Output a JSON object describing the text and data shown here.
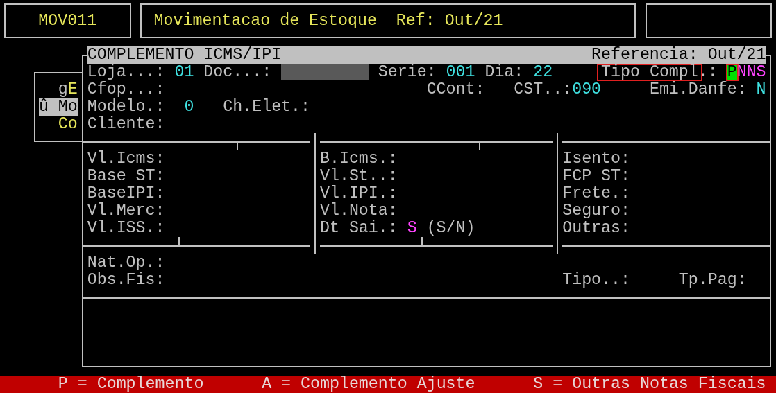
{
  "header": {
    "program_code": "MOV011",
    "title": "Movimentacao de Estoque",
    "reference": "Ref: Out/21"
  },
  "background_menu": {
    "items": [
      {
        "parts": [
          {
            "text": "g",
            "hotkey": false
          },
          {
            "text": "E",
            "hotkey": true
          }
        ],
        "selected": false
      },
      {
        "parts": [
          {
            "text": "û Mo"
          }
        ],
        "selected": true
      },
      {
        "parts": [
          {
            "text": "Co",
            "hotkey": true
          }
        ],
        "selected": false
      }
    ]
  },
  "dialog": {
    "title": "COMPLEMENTO ICMS/IPI",
    "reference": "Referencia: Out/21",
    "loja": {
      "label": "Loja...:",
      "value": "01"
    },
    "doc": {
      "label": "Doc...:",
      "redacted": true
    },
    "serie": {
      "label": "Serie:",
      "value": "001"
    },
    "dia": {
      "label": "Dia:",
      "value": "22"
    },
    "tipo_compl": {
      "label": "Tipo Compl",
      "highlighted": true,
      "suffix": ".:",
      "options": [
        {
          "char": "P",
          "cursor": true
        },
        {
          "char": "N",
          "cursor": false
        },
        {
          "char": "N",
          "cursor": false
        },
        {
          "char": "S",
          "cursor": false
        }
      ]
    },
    "cfop": {
      "label": "Cfop...:"
    },
    "ccont": {
      "label": "CCont:"
    },
    "cst": {
      "label": "CST..:",
      "value": "090"
    },
    "emi_danfe": {
      "label": "Emi.Danfe:",
      "value": "N"
    },
    "modelo": {
      "label": "Modelo.:",
      "value": "0"
    },
    "ch_elet": {
      "label": "Ch.Elet.:"
    },
    "cliente": {
      "label": "Cliente:"
    },
    "value_columns": [
      [
        {
          "label": "Vl.Icms:"
        },
        {
          "label": "Base ST:"
        },
        {
          "label": "BaseIPI:"
        },
        {
          "label": "Vl.Merc:"
        },
        {
          "label": "Vl.ISS.:"
        }
      ],
      [
        {
          "label": "B.Icms.:"
        },
        {
          "label": "Vl.St..:"
        },
        {
          "label": "Vl.IPI.:"
        },
        {
          "label": "Vl.Nota:"
        },
        {
          "label": "Dt Sai.:",
          "value": "S",
          "hint": "(S/N)"
        }
      ],
      [
        {
          "label": "Isento:"
        },
        {
          "label": "FCP ST:"
        },
        {
          "label": "Frete.:"
        },
        {
          "label": "Seguro:"
        },
        {
          "label": "Outras:"
        }
      ]
    ],
    "nat_op": {
      "label": "Nat.Op.:"
    },
    "obs_fis": {
      "label": "Obs.Fis:"
    },
    "tipo": {
      "label": "Tipo..:"
    },
    "tp_pag": {
      "label": "Tp.Pag:"
    }
  },
  "status_bar": [
    "P = Complemento",
    "A = Complemento Ajuste",
    "S = Outras Notas Fiscais"
  ]
}
